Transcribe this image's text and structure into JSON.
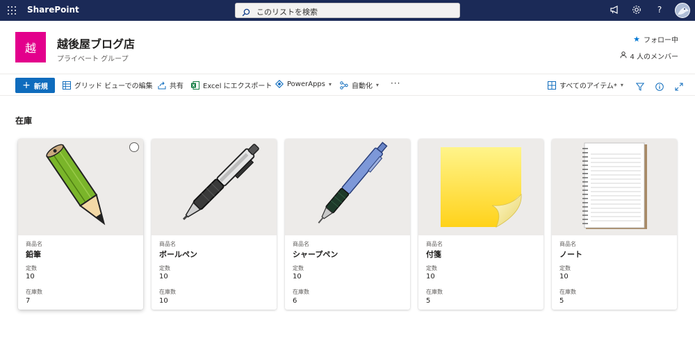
{
  "suite": {
    "app_name": "SharePoint",
    "search_placeholder": "このリストを検索"
  },
  "site": {
    "logo_char": "越",
    "logo_color": "#e3008c",
    "title": "越後屋ブログ店",
    "subtitle": "プライベート グループ",
    "follow_label": "フォロー中",
    "members_label": "4 人のメンバー"
  },
  "commands": {
    "new_label": "新規",
    "grid_edit": "グリッド ビューでの編集",
    "share": "共有",
    "excel_export": "Excel にエクスポート",
    "powerapps": "PowerApps",
    "automate": "自動化",
    "more": "···",
    "view_label": "すべてのアイテム*"
  },
  "section_title": "在庫",
  "field_labels": {
    "name": "商品名",
    "quantity": "定数",
    "stock": "在庫数"
  },
  "items": [
    {
      "name": "鉛筆",
      "quantity": "10",
      "stock": "7",
      "image": "pencil"
    },
    {
      "name": "ボールペン",
      "quantity": "10",
      "stock": "10",
      "image": "ballpoint-pen"
    },
    {
      "name": "シャープペン",
      "quantity": "10",
      "stock": "6",
      "image": "mechanical-pencil"
    },
    {
      "name": "付箋",
      "quantity": "10",
      "stock": "5",
      "image": "sticky-note"
    },
    {
      "name": "ノート",
      "quantity": "10",
      "stock": "5",
      "image": "notebook"
    }
  ],
  "colors": {
    "suite_bar": "#1b2a57",
    "accent": "#0f6cbd",
    "card_image_bg": "#edebe9"
  }
}
